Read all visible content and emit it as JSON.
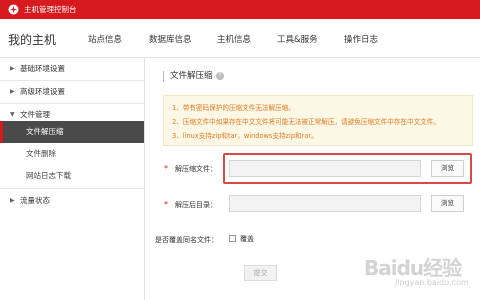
{
  "topbar": {
    "title": "主机管理控制台"
  },
  "header": {
    "page_title": "我的主机",
    "nav": [
      "站点信息",
      "数据库信息",
      "主机信息",
      "工具&服务",
      "操作日志"
    ]
  },
  "sidebar": {
    "groups": [
      {
        "label": "基础环境设置",
        "expanded": false
      },
      {
        "label": "高级环境设置",
        "expanded": false
      },
      {
        "label": "文件管理",
        "expanded": true,
        "children": [
          "文件解压缩",
          "文件删除",
          "网站日志下载"
        ],
        "active_child": "文件解压缩"
      },
      {
        "label": "流量状态",
        "expanded": false
      }
    ]
  },
  "main": {
    "section_title": "文件解压缩",
    "help_icon": "?",
    "notices": [
      "1、带有密码保护的压缩文件无法解压缩。",
      "2、压缩文件中如果存在中文文件将可能无法被正常解压，请避免压缩文件中存在中文文件。",
      "3、linux支持zip和tar，windows支持zip和rar。"
    ],
    "form": {
      "required_mark": "*",
      "archive_label": "解压缩文件：",
      "archive_value": "",
      "target_label": "解压后目录：",
      "target_value": "",
      "browse_label": "浏览",
      "overwrite_label": "是否覆盖同名文件：",
      "overwrite_option": "覆盖",
      "overwrite_checked": false,
      "submit_label": "提交"
    }
  },
  "watermark": {
    "text": "Baidu经验",
    "sub": "jingyan.baidu.com"
  },
  "colors": {
    "brand": "#d71920",
    "notice_text": "#e07b23",
    "notice_bg": "#fdf7e5",
    "highlight": "#d84a44"
  }
}
